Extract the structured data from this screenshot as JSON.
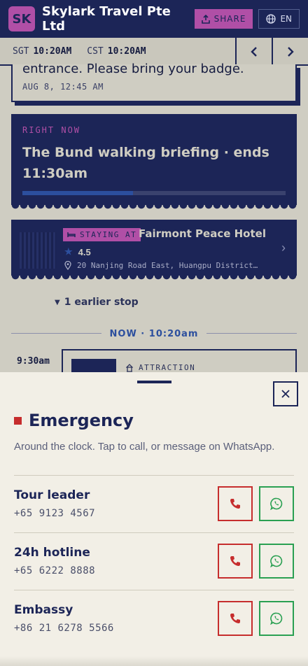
{
  "header": {
    "logo_initials": "SK",
    "company": "Skylark Travel Pte Ltd",
    "share_label": "SHARE",
    "lang_label": "EN",
    "colors": {
      "brand": "#1c2557",
      "accent": "#b04fa6"
    }
  },
  "timebar": {
    "zones": [
      {
        "code": "SGT",
        "time": "10:20AM"
      },
      {
        "code": "CST",
        "time": "10:20AM"
      }
    ]
  },
  "timeline": {
    "prev_card": {
      "text": "entrance. Please bring your badge.",
      "date": "AUG 8, 12:45 AM"
    },
    "now_card": {
      "label": "RIGHT NOW",
      "title": "The Bund walking briefing · ends 11:30am",
      "progress": 0.42
    },
    "stay_card": {
      "tag": "STAYING AT",
      "hotel": "Fairmont Peace Hotel",
      "rating": "4.5",
      "address": "20 Nanjing Road East, Huangpu District…"
    },
    "earlier_label": "1 earlier stop",
    "now_marker": "NOW · 10:20am",
    "next_item": {
      "time": "9:30am",
      "tag": "ATTRACTION"
    }
  },
  "sheet": {
    "title": "Emergency",
    "subtitle": "Around the clock. Tap to call, or message on WhatsApp.",
    "contacts": [
      {
        "name": "Tour leader",
        "number": "+65 9123 4567"
      },
      {
        "name": "24h hotline",
        "number": "+65 6222 8888"
      },
      {
        "name": "Embassy",
        "number": "+86 21 6278 5566"
      }
    ],
    "colors": {
      "call": "#c62d2d",
      "whatsapp": "#2aa052"
    }
  }
}
